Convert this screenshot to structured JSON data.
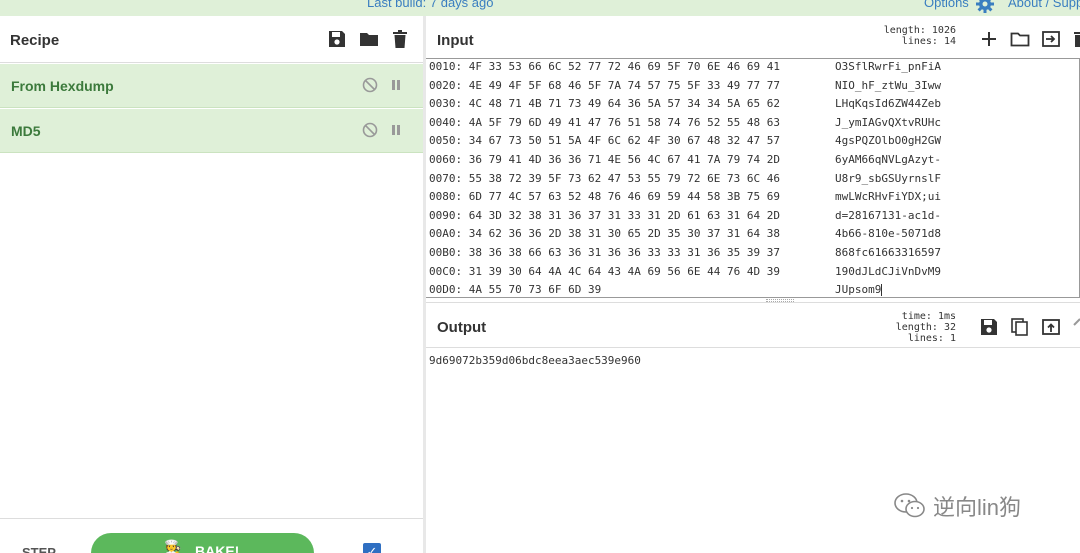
{
  "topbar": {
    "last_build": "Last build: 7 days ago",
    "options": "Options",
    "about": "About / Supp"
  },
  "recipe": {
    "title": "Recipe",
    "operations": [
      {
        "name": "From Hexdump"
      },
      {
        "name": "MD5"
      }
    ],
    "step_label": "STEP",
    "bake_label": "BAKE!",
    "bake_icon": "🧑‍🍳",
    "auto_bake_checked": true
  },
  "input": {
    "title": "Input",
    "length_label": "length:",
    "length_value": "1026",
    "lines_label": "lines:",
    "lines_value": "14",
    "rows": [
      {
        "hex": "0010: 4F 33 53 66 6C 52 77 72 46 69 5F 70 6E 46 69 41",
        "ascii": "O3SflRwrFi_pnFiA"
      },
      {
        "hex": "0020: 4E 49 4F 5F 68 46 5F 7A 74 57 75 5F 33 49 77 77",
        "ascii": "NIO_hF_ztWu_3Iww"
      },
      {
        "hex": "0030: 4C 48 71 4B 71 73 49 64 36 5A 57 34 34 5A 65 62",
        "ascii": "LHqKqsId6ZW44Zeb"
      },
      {
        "hex": "0040: 4A 5F 79 6D 49 41 47 76 51 58 74 76 52 55 48 63",
        "ascii": "J_ymIAGvQXtvRUHc"
      },
      {
        "hex": "0050: 34 67 73 50 51 5A 4F 6C 62 4F 30 67 48 32 47 57",
        "ascii": "4gsPQZOlbO0gH2GW"
      },
      {
        "hex": "0060: 36 79 41 4D 36 36 71 4E 56 4C 67 41 7A 79 74 2D",
        "ascii": "6yAM66qNVLgAzyt-"
      },
      {
        "hex": "0070: 55 38 72 39 5F 73 62 47 53 55 79 72 6E 73 6C 46",
        "ascii": "U8r9_sbGSUyrnslF"
      },
      {
        "hex": "0080: 6D 77 4C 57 63 52 48 76 46 69 59 44 58 3B 75 69",
        "ascii": "mwLWcRHvFiYDX;ui"
      },
      {
        "hex": "0090: 64 3D 32 38 31 36 37 31 33 31 2D 61 63 31 64 2D",
        "ascii": "d=28167131-ac1d-"
      },
      {
        "hex": "00A0: 34 62 36 36 2D 38 31 30 65 2D 35 30 37 31 64 38",
        "ascii": "4b66-810e-5071d8"
      },
      {
        "hex": "00B0: 38 36 38 66 63 36 31 36 36 33 33 31 36 35 39 37",
        "ascii": "868fc61663316597"
      },
      {
        "hex": "00C0: 31 39 30 64 4A 4C 64 43 4A 69 56 6E 44 76 4D 39",
        "ascii": "190dJLdCJiVnDvM9"
      },
      {
        "hex": "00D0: 4A 55 70 73 6F 6D 39",
        "ascii": "JUpsom9"
      }
    ]
  },
  "output": {
    "title": "Output",
    "time_label": "time:",
    "time_value": "1ms",
    "length_label": "length:",
    "length_value": "32",
    "lines_label": "lines:",
    "lines_value": "1",
    "text": "9d69072b359d06bdc8eea3aec539e960"
  },
  "watermark": {
    "text": "逆向lin狗"
  },
  "colors": {
    "accent_green": "#5cb85c",
    "op_background": "#dff0d8",
    "link_blue": "#3a7ec0"
  }
}
